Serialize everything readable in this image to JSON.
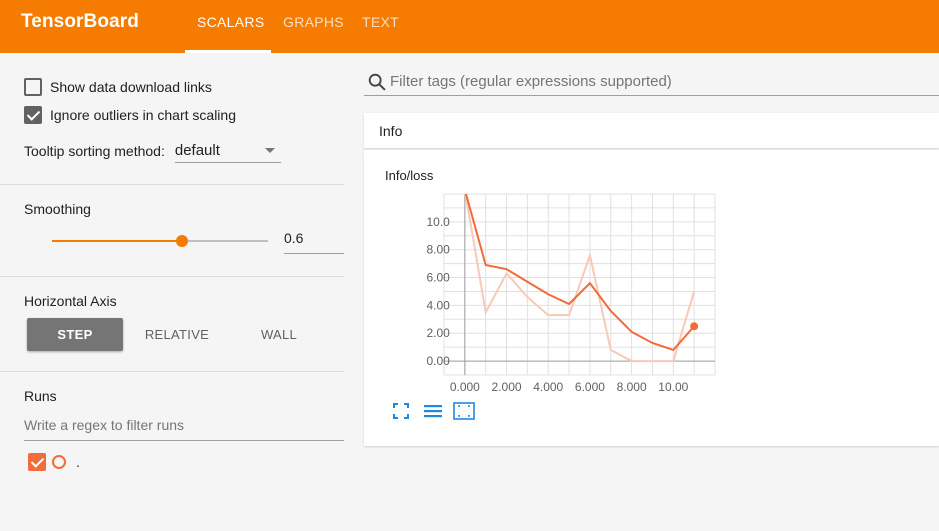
{
  "app": {
    "title": "TensorBoard",
    "tabs": [
      {
        "label": "SCALARS",
        "active": true
      },
      {
        "label": "GRAPHS",
        "active": false
      },
      {
        "label": "TEXT",
        "active": false
      }
    ],
    "accent": "#f57c00"
  },
  "sidebar": {
    "show_download_links": {
      "label": "Show data download links",
      "checked": false
    },
    "ignore_outliers": {
      "label": "Ignore outliers in chart scaling",
      "checked": true
    },
    "tooltip_sorting": {
      "label": "Tooltip sorting method:",
      "value": "default"
    },
    "smoothing": {
      "title": "Smoothing",
      "value": "0.6",
      "fraction": 0.6
    },
    "horizontal_axis": {
      "title": "Horizontal Axis",
      "options": [
        "STEP",
        "RELATIVE",
        "WALL"
      ],
      "selected": "STEP"
    },
    "runs": {
      "title": "Runs",
      "filter_placeholder": "Write a regex to filter runs",
      "items": [
        {
          "name": ".",
          "checked": true,
          "color": "#f26b3a"
        }
      ]
    }
  },
  "main": {
    "search_placeholder": "Filter tags (regular expressions supported)",
    "category": "Info",
    "chart_title": "Info/loss",
    "icons": [
      "fullscreen-icon",
      "list-icon",
      "fit-domain-icon"
    ]
  },
  "chart_data": {
    "type": "line",
    "title": "Info/loss",
    "xlim": [
      -1,
      12
    ],
    "ylim": [
      -1,
      12
    ],
    "x_ticks": [
      "0.000",
      "2.000",
      "4.000",
      "6.000",
      "8.000",
      "10.00"
    ],
    "y_ticks": [
      "0.00",
      "2.00",
      "4.00",
      "6.00",
      "8.00",
      "10.0"
    ],
    "series": [
      {
        "x": [
          0,
          1,
          2,
          3,
          4,
          5,
          6,
          7,
          8,
          9,
          10,
          11
        ],
        "values": [
          12.3,
          3.5,
          6.3,
          4.6,
          3.3,
          3.3,
          7.6,
          0.8,
          0.0,
          0.0,
          0.0,
          5.0
        ],
        "color": "#f8c9b6"
      },
      {
        "x": [
          0,
          1,
          2,
          3,
          4,
          5,
          6,
          7,
          8,
          9,
          10,
          11
        ],
        "values": [
          12.3,
          6.9,
          6.6,
          5.7,
          4.8,
          4.1,
          5.6,
          3.6,
          2.1,
          1.3,
          0.8,
          2.5
        ],
        "color": "#f26b3a"
      }
    ]
  }
}
